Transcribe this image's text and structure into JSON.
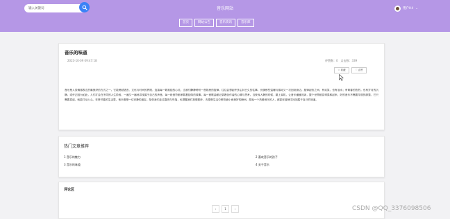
{
  "header": {
    "search_placeholder": "输入关键词",
    "site_title": "音乐网站",
    "username": "用户H4",
    "user_caret": "⌄"
  },
  "nav": {
    "items": [
      "首页",
      "网站公告",
      "音乐资讯",
      "音乐库"
    ]
  },
  "article": {
    "title": "音乐的味道",
    "date": "2023-10-09 09:47:18",
    "stats": "评赞数：0　点击数：339",
    "btn_fav": "收藏",
    "btn_like": "点赞",
    "body": "音乐是人类情感表达的最美好的方式之一。它能跨越语言、文化与时间的界限，连接每一颗孤独的心灵。当我们静静聆听一首熟悉的旋律，往往会想起许多尘封已久的往事，仿佛那些温暖与感动又一次回到身边。旋律起伏之间，有欢笑，也有泪水；有青春的热烈，也有岁月的沉静。或许正因为如此，人们才会在不同的人生阶段，一遍又一遍地寻找属于自己的声音。每一段音符都承载着独特的故事，每一首歌曲都记录着创作者的心情与思考。当夜深人静的时候，戴上耳机，让音乐缓缓流淌，整个世界都变得柔和起来。好的音乐不需要华丽的辞藻，它只需要真诚，就能打动人心。在快节奏的生活里，音乐像是一位安静的朋友，陪伴我们走过喜悦与失落，也提醒我们放慢脚步，去感受生活中那些细小而美好的瞬间。愿每一个热爱音乐的人，都能在旋律中找到属于自己的味道。"
  },
  "hot": {
    "title": "热门文章推荐",
    "items": [
      "1  音乐的魅力",
      "2  喜欢音乐的孩子",
      "3  音乐的味道",
      "4  关于音乐"
    ]
  },
  "comments": {
    "title": "评论区"
  },
  "pager": {
    "prev": "‹",
    "page": "1",
    "next": "›"
  },
  "watermark": "CSDN @QQ_3376098506",
  "colors": {
    "header_bg": "#b597e6",
    "search_button": "#3b82f6",
    "page_bg": "#f2f2f4"
  }
}
